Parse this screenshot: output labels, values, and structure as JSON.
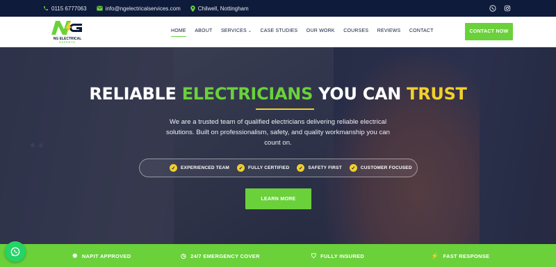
{
  "topbar": {
    "phone": "0115 6777063",
    "email": "info@ngelectricalservices.com",
    "location": "Chilwell, Nottingham",
    "icons": [
      "phone-icon",
      "envelope-icon",
      "map-pin-icon",
      "whatsapp-icon",
      "instagram-icon"
    ]
  },
  "logo": {
    "mark": "NG",
    "name": "NG ELECTRICAL",
    "tagline": "EXPERTS"
  },
  "nav": {
    "items": [
      {
        "label": "HOME"
      },
      {
        "label": "ABOUT"
      },
      {
        "label": "SERVICES"
      },
      {
        "label": "CASE STUDIES"
      },
      {
        "label": "OUR WORK"
      },
      {
        "label": "COURSES"
      },
      {
        "label": "REVIEWS"
      },
      {
        "label": "CONTACT"
      }
    ],
    "cta": "CONTACT NOW"
  },
  "hero": {
    "headline_1": "RELIABLE ",
    "headline_2": "ELECTRICIANS",
    "headline_3": " YOU CAN ",
    "headline_4": "TRUST",
    "lead": "We are a trusted team of qualified electricians delivering reliable electrical solutions. Built on professionalism, safety, and quality workmanship you can count on.",
    "features": [
      {
        "label": "EXPERIENCED TEAM"
      },
      {
        "label": "FULLY CERTIFIED"
      },
      {
        "label": "SAFETY FIRST"
      },
      {
        "label": "CUSTOMER FOCUSED"
      }
    ],
    "button": "LEARN MORE"
  },
  "strip": {
    "items": [
      {
        "label": "NAPIT APPROVED",
        "icon": "badge-icon"
      },
      {
        "label": "24/7 EMERGENCY COVER",
        "icon": "clock-icon"
      },
      {
        "label": "FULLY INSURED",
        "icon": "shield-icon"
      },
      {
        "label": "FAST RESPONSE",
        "icon": "lightning-icon"
      }
    ]
  },
  "colors": {
    "navy": "#0e1b3b",
    "green": "#6ad13a",
    "yellow": "#f2d02c",
    "whatsapp": "#25d366"
  }
}
